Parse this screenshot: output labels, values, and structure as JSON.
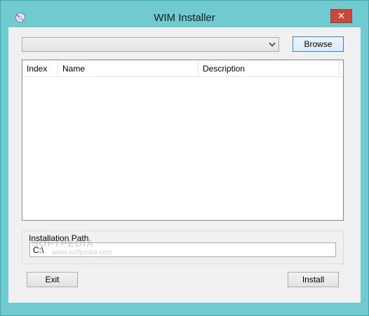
{
  "window": {
    "title": "WIM Installer",
    "close_glyph": "✕"
  },
  "image_select": {
    "value": ""
  },
  "toolbar": {
    "browse_label": "Browse"
  },
  "list": {
    "columns": [
      "Index",
      "Name",
      "Description"
    ],
    "rows": []
  },
  "install_path": {
    "group_label": "Installation Path",
    "value": "C:\\"
  },
  "watermark": {
    "main": "SOFTPEDIA",
    "sub": "www.softpedia.com"
  },
  "footer": {
    "exit_label": "Exit",
    "install_label": "Install"
  },
  "colors": {
    "frame": "#6fcbcf",
    "close": "#c9473b",
    "client": "#f0f0f0"
  }
}
